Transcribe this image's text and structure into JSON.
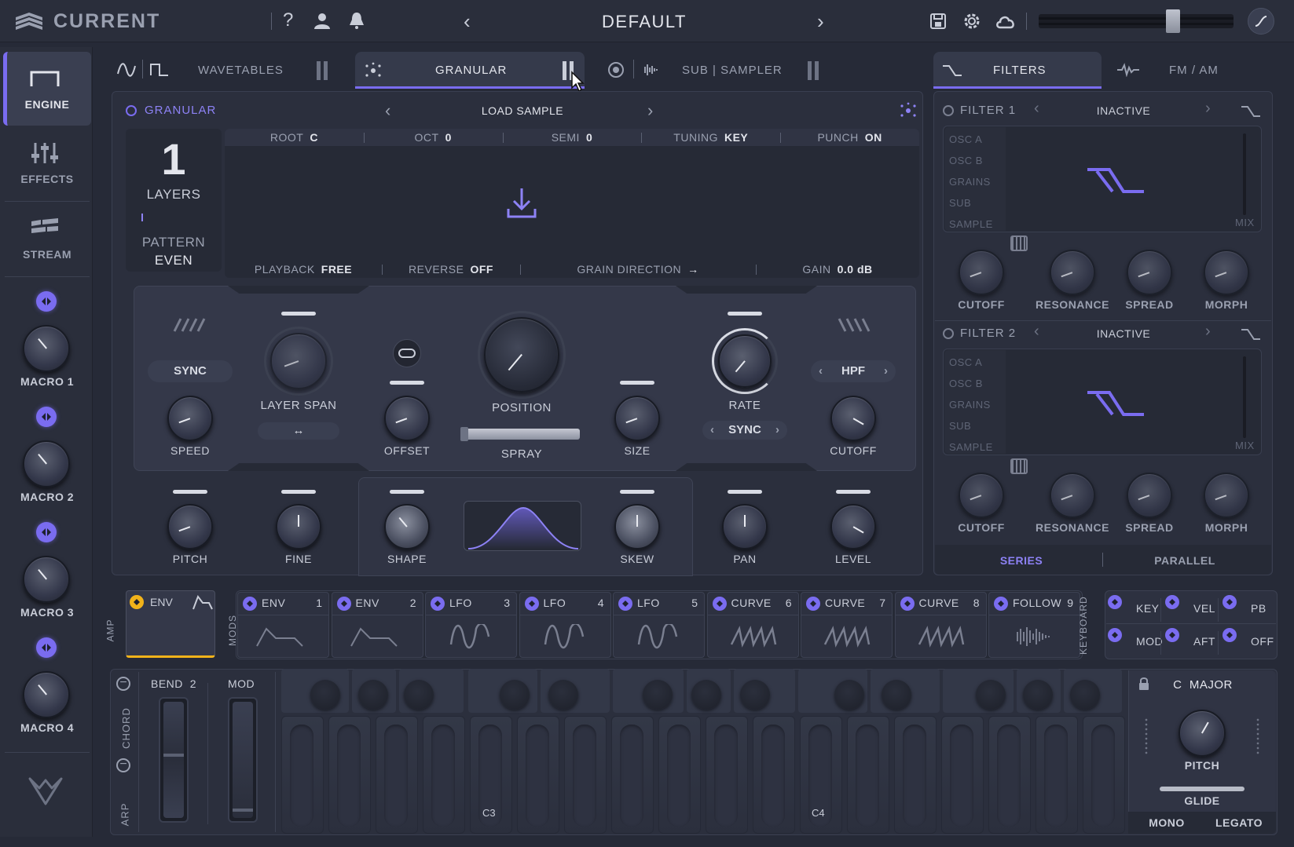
{
  "topbar": {
    "brand": "CURRENT",
    "preset_name": "DEFAULT"
  },
  "sidebar": {
    "engine": "ENGINE",
    "effects": "EFFECTS",
    "stream": "STREAM",
    "macros": [
      "MACRO 1",
      "MACRO 2",
      "MACRO 3",
      "MACRO 4"
    ]
  },
  "tabs": {
    "wavetables": "WAVETABLES",
    "granular": "GRANULAR",
    "sub_sampler": "SUB | SAMPLER",
    "filters": "FILTERS",
    "fm_am": "FM / AM"
  },
  "granular": {
    "title": "GRANULAR",
    "load_sample": "LOAD SAMPLE",
    "layers_count": "1",
    "layers_label": "LAYERS",
    "pattern_label": "PATTERN",
    "pattern_value": "EVEN",
    "params_top": [
      {
        "label": "ROOT",
        "value": "C"
      },
      {
        "label": "OCT",
        "value": "0"
      },
      {
        "label": "SEMI",
        "value": "0"
      },
      {
        "label": "TUNING",
        "value": "KEY"
      },
      {
        "label": "PUNCH",
        "value": "ON"
      }
    ],
    "params_bottom": [
      {
        "label": "PLAYBACK",
        "value": "FREE"
      },
      {
        "label": "REVERSE",
        "value": "OFF"
      },
      {
        "label": "GRAIN DIRECTION",
        "value": "→"
      },
      {
        "label": "GAIN",
        "value": "0.0 dB"
      }
    ],
    "controls": {
      "sync": "SYNC",
      "speed": "SPEED",
      "layer_span": "LAYER SPAN",
      "offset": "OFFSET",
      "position": "POSITION",
      "spray": "SPRAY",
      "size": "SIZE",
      "rate": "RATE",
      "rate_sync": "SYNC",
      "filter_type": "HPF",
      "cutoff": "CUTOFF",
      "pitch": "PITCH",
      "fine": "FINE",
      "shape": "SHAPE",
      "skew": "SKEW",
      "pan": "PAN",
      "level": "LEVEL"
    }
  },
  "filters": {
    "filter1": {
      "title": "FILTER 1",
      "state": "INACTIVE"
    },
    "filter2": {
      "title": "FILTER 2",
      "state": "INACTIVE"
    },
    "sources": [
      "OSC A",
      "OSC B",
      "GRAINS",
      "SUB",
      "SAMPLE"
    ],
    "mix": "MIX",
    "knobs": [
      "CUTOFF",
      "RESONANCE",
      "SPREAD",
      "MORPH"
    ],
    "series": "SERIES",
    "parallel": "PARALLEL"
  },
  "mods": {
    "amp_label": "AMP",
    "mods_label": "MODS",
    "keyboard_label": "KEYBOARD",
    "amp_env": "ENV",
    "slots": [
      {
        "name": "ENV",
        "num": "1",
        "shape": "env"
      },
      {
        "name": "ENV",
        "num": "2",
        "shape": "env"
      },
      {
        "name": "LFO",
        "num": "3",
        "shape": "sine"
      },
      {
        "name": "LFO",
        "num": "4",
        "shape": "sine"
      },
      {
        "name": "LFO",
        "num": "5",
        "shape": "sine"
      },
      {
        "name": "CURVE",
        "num": "6",
        "shape": "zigzag"
      },
      {
        "name": "CURVE",
        "num": "7",
        "shape": "zigzag"
      },
      {
        "name": "CURVE",
        "num": "8",
        "shape": "zigzag"
      },
      {
        "name": "FOLLOW",
        "num": "9",
        "shape": "wave"
      }
    ],
    "keyboard_sources": [
      "KEY",
      "VEL",
      "PB",
      "MOD",
      "AFT",
      "OFF"
    ]
  },
  "keyboard": {
    "chord": "CHORD",
    "arp": "ARP",
    "bend_label": "BEND",
    "bend_value": "2",
    "mod_label": "MOD",
    "c3": "C3",
    "c4": "C4",
    "scale": "C  MAJOR",
    "pitch": "PITCH",
    "glide": "GLIDE",
    "mono": "MONO",
    "legato": "LEGATO"
  },
  "colors": {
    "accent": "#7a6cf0",
    "background": "#262a37",
    "panel": "#2d3140",
    "amp_env_toggle": "#f2b31a"
  }
}
